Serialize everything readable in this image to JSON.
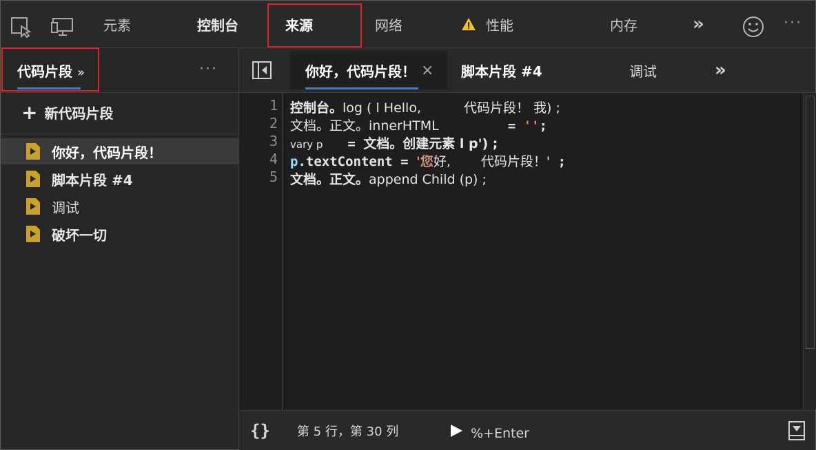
{
  "toolbar": {
    "tabs": [
      {
        "label": "元素"
      },
      {
        "label": "控制台"
      },
      {
        "label": "来源"
      },
      {
        "label": "网络"
      },
      {
        "label": "性能"
      },
      {
        "label": "内存"
      }
    ],
    "more_tabs": "»",
    "warning_icon": "warning-triangle-icon",
    "colors": {
      "highlight_border": "#e0202a",
      "accent_underline": "#3d7cde",
      "warning": "#f5c518"
    }
  },
  "left_panel": {
    "title": "代码片段",
    "chevron": "»",
    "menu": "···",
    "new_snippet_label": "新代码片段",
    "snippets": [
      {
        "label": "你好，代码片段！",
        "selected": true
      },
      {
        "label": "脚本片段 #4"
      },
      {
        "label": "调试"
      },
      {
        "label": "破坏一切"
      }
    ]
  },
  "editor": {
    "tabs": [
      {
        "label": "你好，代码片段！",
        "close": "×"
      },
      {
        "label": "脚本片段 #4"
      },
      {
        "label": "调试"
      }
    ],
    "more": "»",
    "lines": [
      {
        "num": "1",
        "parts": [
          "控制台。",
          "log ( l Hello,",
          "代码片段！ 我) ;"
        ]
      },
      {
        "num": "2",
        "parts": [
          "文档。正文。innerHTML",
          "= ",
          "''",
          ";"
        ]
      },
      {
        "num": "3",
        "parts": [
          "vary p",
          "= ",
          "文档。创建元素 l p') ;"
        ]
      },
      {
        "num": "4",
        "parts": [
          "p",
          ".textContent = ",
          "'您",
          "好,",
          "代码片段！'",
          " ;"
        ]
      },
      {
        "num": "5",
        "parts": [
          "文档。正文。",
          "append Child (p) ;"
        ]
      }
    ]
  },
  "status": {
    "format_icon": "{}",
    "position": "第 5 行，第 30 列",
    "run_shortcut": "%+Enter"
  }
}
